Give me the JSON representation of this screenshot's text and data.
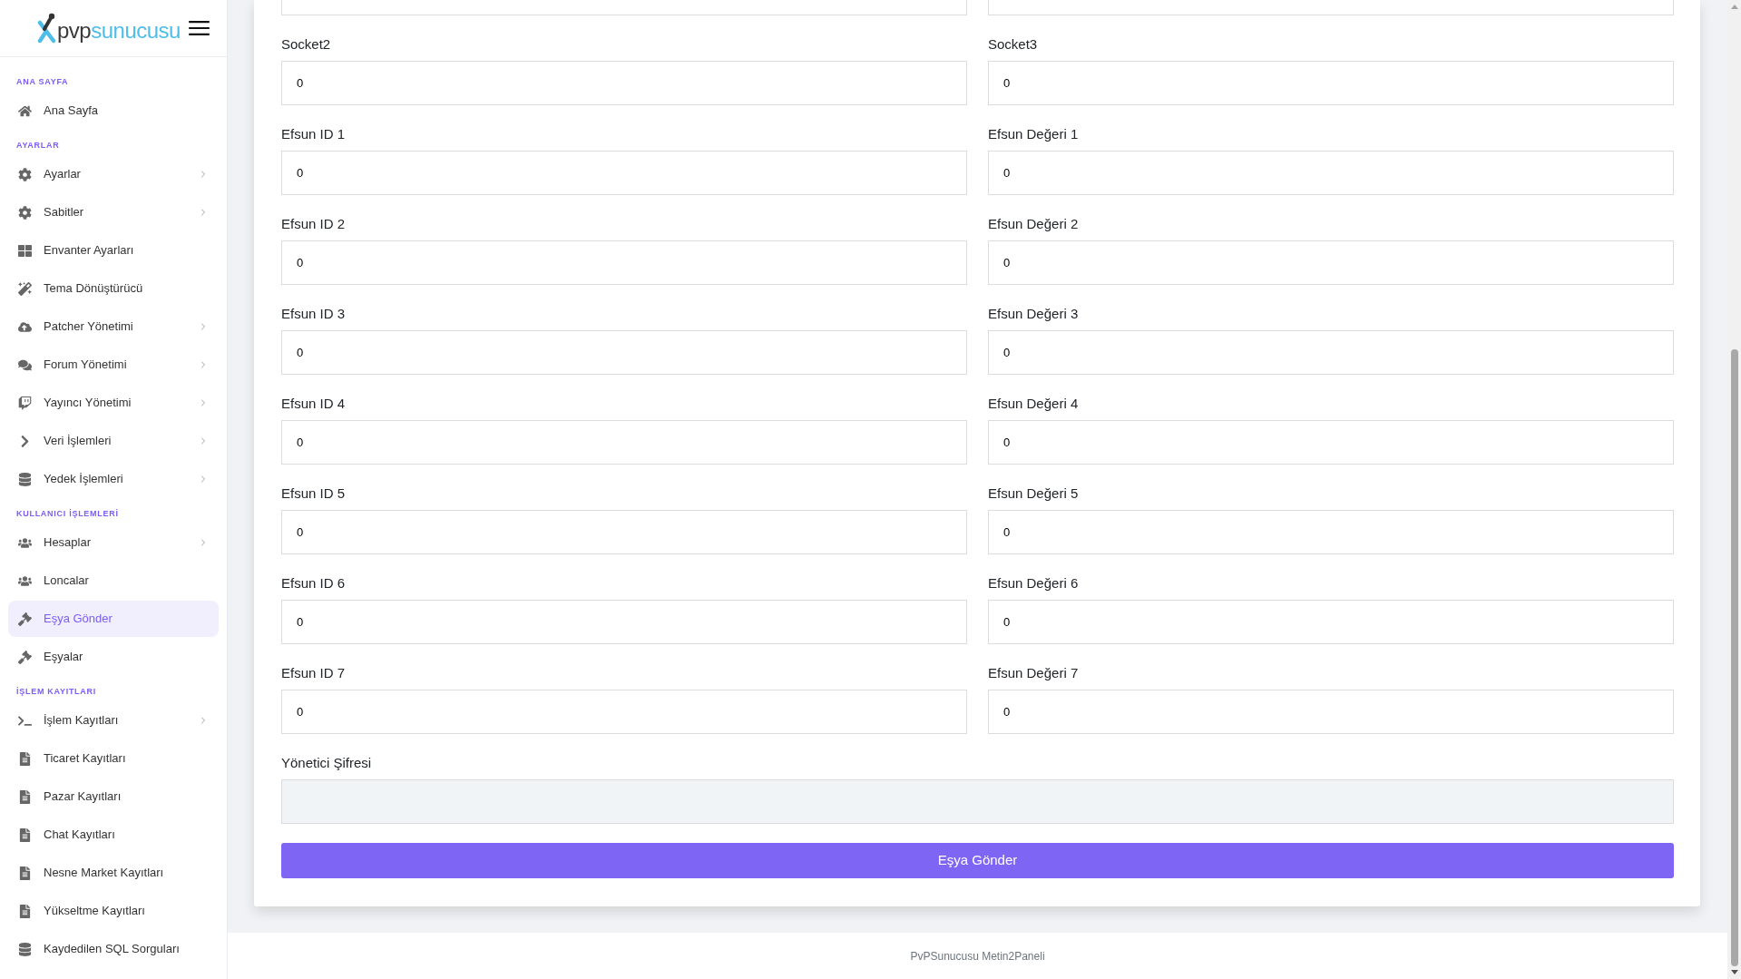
{
  "sidebar": {
    "logo": {
      "text_dark": "pvp",
      "text_light": "sunucusu"
    },
    "sections": [
      {
        "title": "ANA SAYFA",
        "items": [
          {
            "label": "Ana Sayfa",
            "expandable": false,
            "selected": false
          }
        ]
      },
      {
        "title": "AYARLAR",
        "items": [
          {
            "label": "Ayarlar",
            "expandable": true,
            "selected": false
          },
          {
            "label": "Sabitler",
            "expandable": true,
            "selected": false
          },
          {
            "label": "Envanter Ayarları",
            "expandable": false,
            "selected": false
          },
          {
            "label": "Tema Dönüştürücü",
            "expandable": false,
            "selected": false
          },
          {
            "label": "Patcher Yönetimi",
            "expandable": true,
            "selected": false
          },
          {
            "label": "Forum Yönetimi",
            "expandable": true,
            "selected": false
          },
          {
            "label": "Yayıncı Yönetimi",
            "expandable": true,
            "selected": false
          },
          {
            "label": "Veri İşlemleri",
            "expandable": true,
            "selected": false
          },
          {
            "label": "Yedek İşlemleri",
            "expandable": true,
            "selected": false
          }
        ]
      },
      {
        "title": "KULLANICI İŞLEMLERİ",
        "items": [
          {
            "label": "Hesaplar",
            "expandable": true,
            "selected": false
          },
          {
            "label": "Loncalar",
            "expandable": false,
            "selected": false
          },
          {
            "label": "Eşya Gönder",
            "expandable": false,
            "selected": true
          },
          {
            "label": "Eşyalar",
            "expandable": false,
            "selected": false
          }
        ]
      },
      {
        "title": "İŞLEM KAYITLARI",
        "items": [
          {
            "label": "İşlem Kayıtları",
            "expandable": true,
            "selected": false
          },
          {
            "label": "Ticaret Kayıtları",
            "expandable": false,
            "selected": false
          },
          {
            "label": "Pazar Kayıtları",
            "expandable": false,
            "selected": false
          },
          {
            "label": "Chat Kayıtları",
            "expandable": false,
            "selected": false
          },
          {
            "label": "Nesne Market Kayıtları",
            "expandable": false,
            "selected": false
          },
          {
            "label": "Yükseltme Kayıtları",
            "expandable": false,
            "selected": false
          },
          {
            "label": "Kaydedilen SQL Sorguları",
            "expandable": false,
            "selected": false
          }
        ]
      }
    ]
  },
  "form": {
    "fields": [
      {
        "kind": "partial"
      },
      {
        "kind": "partial"
      },
      {
        "kind": "text",
        "label": "Socket2",
        "value": "0"
      },
      {
        "kind": "text",
        "label": "Socket3",
        "value": "0"
      },
      {
        "kind": "text",
        "label": "Efsun ID 1",
        "value": "0"
      },
      {
        "kind": "text",
        "label": "Efsun Değeri 1",
        "value": "0"
      },
      {
        "kind": "text",
        "label": "Efsun ID 2",
        "value": "0"
      },
      {
        "kind": "text",
        "label": "Efsun Değeri 2",
        "value": "0"
      },
      {
        "kind": "text",
        "label": "Efsun ID 3",
        "value": "0"
      },
      {
        "kind": "text",
        "label": "Efsun Değeri 3",
        "value": "0"
      },
      {
        "kind": "text",
        "label": "Efsun ID 4",
        "value": "0"
      },
      {
        "kind": "text",
        "label": "Efsun Değeri 4",
        "value": "0"
      },
      {
        "kind": "text",
        "label": "Efsun ID 5",
        "value": "0"
      },
      {
        "kind": "text",
        "label": "Efsun Değeri 5",
        "value": "0"
      },
      {
        "kind": "text",
        "label": "Efsun ID 6",
        "value": "0"
      },
      {
        "kind": "text",
        "label": "Efsun Değeri 6",
        "value": "0"
      },
      {
        "kind": "text",
        "label": "Efsun ID 7",
        "value": "0"
      },
      {
        "kind": "text",
        "label": "Efsun Değeri 7",
        "value": "0"
      }
    ],
    "admin_password": {
      "label": "Yönetici Şifresi"
    },
    "submit_button": "Eşya Gönder"
  },
  "footer": {
    "text": "PvPSunucusu Metin2Paneli"
  }
}
